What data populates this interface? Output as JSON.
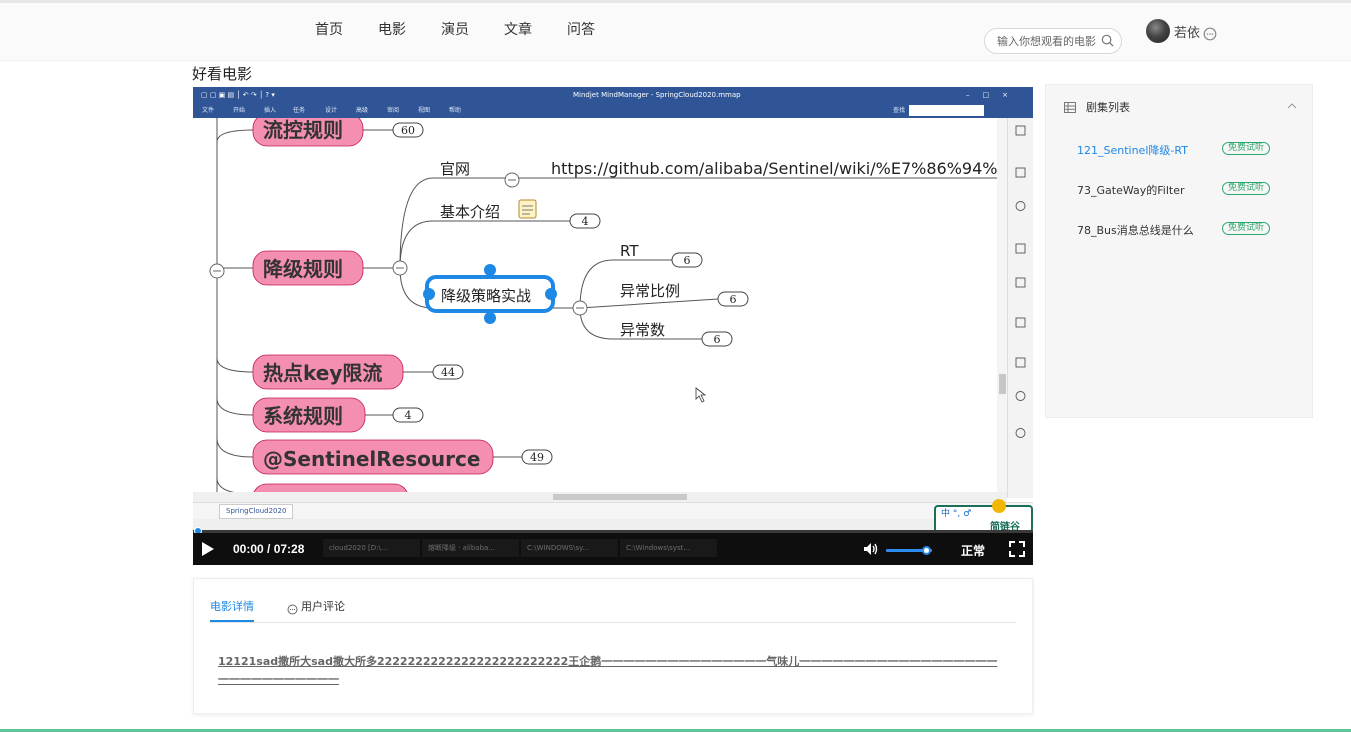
{
  "nav": {
    "items": [
      "首页",
      "电影",
      "演员",
      "文章",
      "问答"
    ]
  },
  "search": {
    "placeholder": "输入你想观看的电影"
  },
  "user": {
    "name": "若依"
  },
  "page_title": "好看电影",
  "mindmap": {
    "window_title": "Mindjet MindManager - SpringCloud2020.mmap",
    "menu": [
      "文件",
      "开始",
      "插入",
      "任务",
      "设计",
      "高级",
      "审阅",
      "视图",
      "帮助"
    ],
    "find_label": "查找",
    "tab_label": "SpringCloud2020",
    "nodes": {
      "flow": "流控规则",
      "flow_count": "60",
      "official": "官网",
      "official_url": "https://github.com/alibaba/Sentinel/wiki/%E7%86%94%",
      "intro": "基本介绍",
      "intro_count": "4",
      "degrade": "降级规则",
      "strategy": "降级策略实战",
      "rt": "RT",
      "rt_count": "6",
      "ratio": "异常比例",
      "ratio_count": "6",
      "count": "异常数",
      "count_count": "6",
      "hotkey": "热点key限流",
      "hotkey_count": "44",
      "system": "系统规则",
      "system_count": "4",
      "resource": "@SentinelResource",
      "resource_count": "49"
    },
    "brand": "简链谷"
  },
  "taskbar": [
    "cloud2020 [D:\\...",
    "熔断降级 · alibaba...",
    "C:\\WINDOWS\\sy...",
    "C:\\Windows\\syst..."
  ],
  "player": {
    "time": "00:00 / 07:28",
    "speed": "正常",
    "progress": 0.0,
    "volume": 0.8
  },
  "playlist": {
    "title": "剧集列表",
    "items": [
      {
        "name": "121_Sentinel降级-RT",
        "badge": "免费试听"
      },
      {
        "name": "73_GateWay的Filter",
        "badge": "免费试听"
      },
      {
        "name": "78_Bus消息总线是什么",
        "badge": "免费试听"
      }
    ]
  },
  "detail": {
    "tabs": [
      "电影详情",
      "用户评论"
    ],
    "description": "12121sad撒所大sad撒大所多2222222222222222222222222王企鹅一一一一一一一一一一一一一一一气味儿一一一一一一一一一一一一一一一一一一一一一一一一一一一一一"
  },
  "colors": {
    "accent": "#1e88e5",
    "mindmap_pink": "#f48fb1",
    "titlebar": "#2f5597",
    "badge_green": "#2ea76d"
  }
}
